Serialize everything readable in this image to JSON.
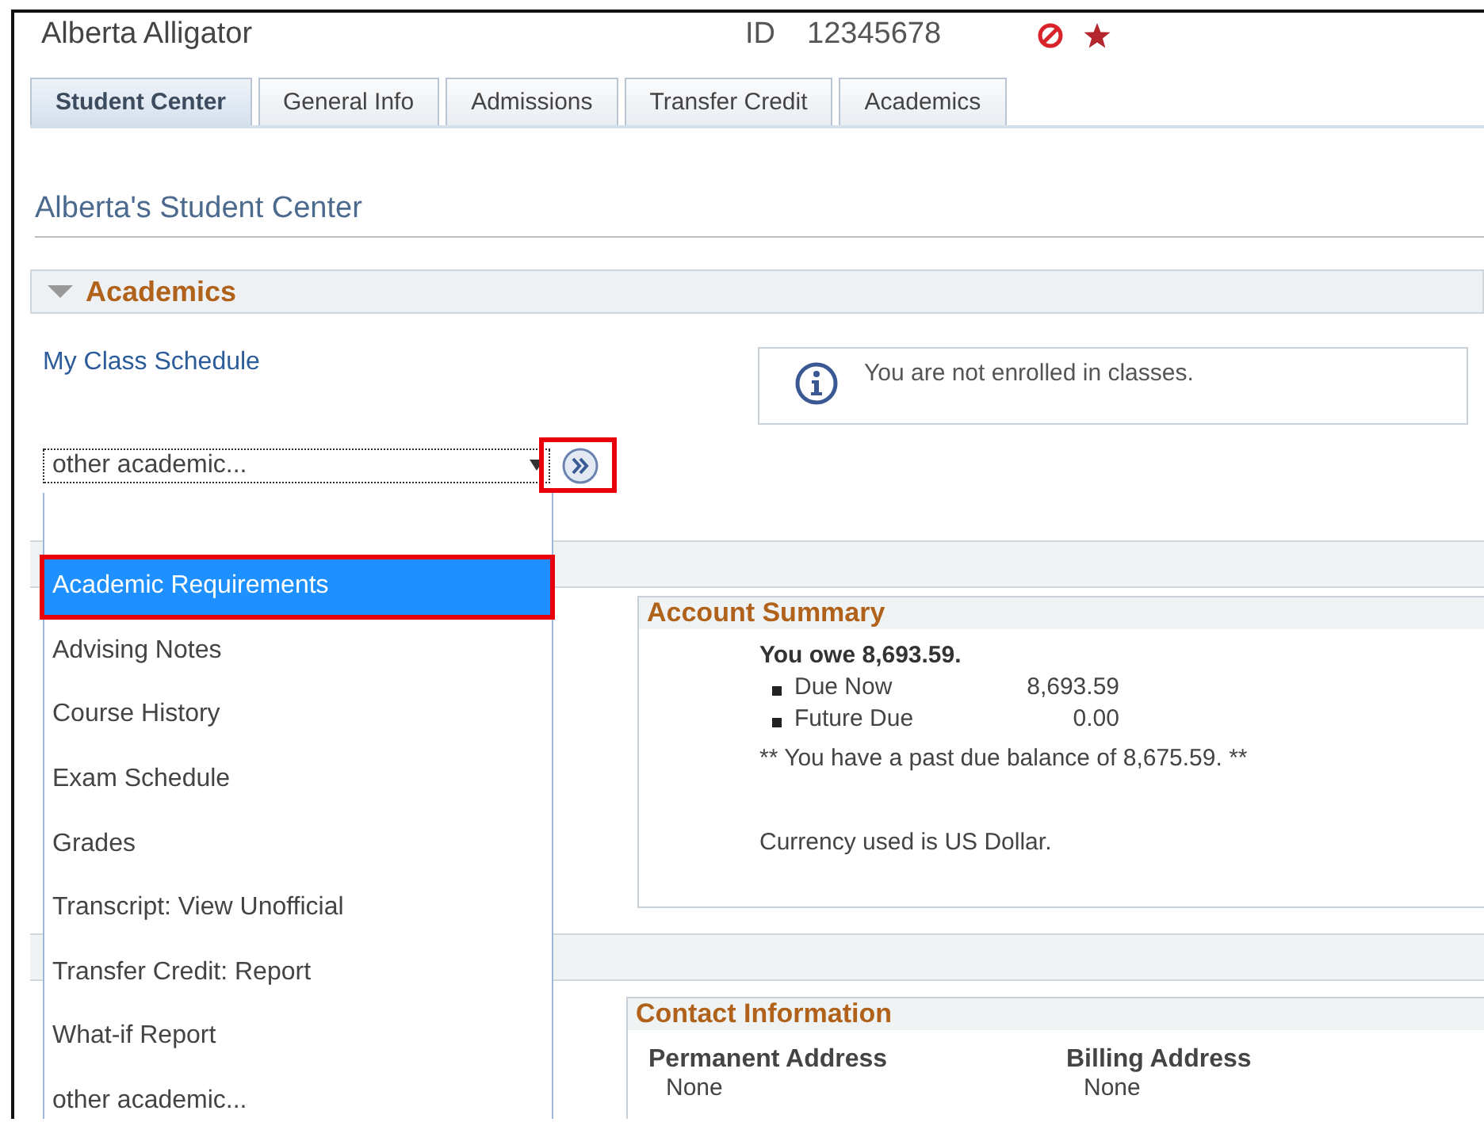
{
  "header": {
    "name": "Alberta Alligator",
    "id_label": "ID",
    "id_value": "12345678"
  },
  "tabs": [
    {
      "label": "Student Center",
      "selected": true
    },
    {
      "label": "General Info",
      "selected": false
    },
    {
      "label": "Admissions",
      "selected": false
    },
    {
      "label": "Transfer Credit",
      "selected": false
    },
    {
      "label": "Academics",
      "selected": false
    }
  ],
  "page_title": "Alberta's Student Center",
  "academics": {
    "title": "Academics",
    "expanded": true,
    "link": "My Class Schedule",
    "notice": "You are not enrolled in classes.",
    "select": {
      "value": "other academic...",
      "open": true
    },
    "go_button": {
      "highlighted": true
    },
    "options": [
      {
        "label": "Academic Requirements",
        "selected": true,
        "highlighted": true
      },
      {
        "label": "Advising Notes",
        "selected": false,
        "highlighted": false
      },
      {
        "label": "Course History",
        "selected": false,
        "highlighted": false
      },
      {
        "label": "Exam Schedule",
        "selected": false,
        "highlighted": false
      },
      {
        "label": "Grades",
        "selected": false,
        "highlighted": false
      },
      {
        "label": "Transcript: View Unofficial",
        "selected": false,
        "highlighted": false
      },
      {
        "label": "Transfer Credit: Report",
        "selected": false,
        "highlighted": false
      },
      {
        "label": "What-if Report",
        "selected": false,
        "highlighted": false
      },
      {
        "label": "other academic...",
        "selected": false,
        "highlighted": false
      }
    ]
  },
  "account_summary": {
    "title": "Account Summary",
    "owe": "You owe 8,693.59.",
    "items": [
      {
        "label": "Due Now",
        "amount": "8,693.59"
      },
      {
        "label": "Future Due",
        "amount": "0.00"
      }
    ],
    "past_due": "** You have a past due balance of 8,675.59. **",
    "currency": "Currency used is US Dollar."
  },
  "contact": {
    "title": "Contact Information",
    "columns": [
      {
        "heading": "Permanent Address",
        "value": "None"
      },
      {
        "heading": "Billing Address",
        "value": "None"
      }
    ]
  }
}
